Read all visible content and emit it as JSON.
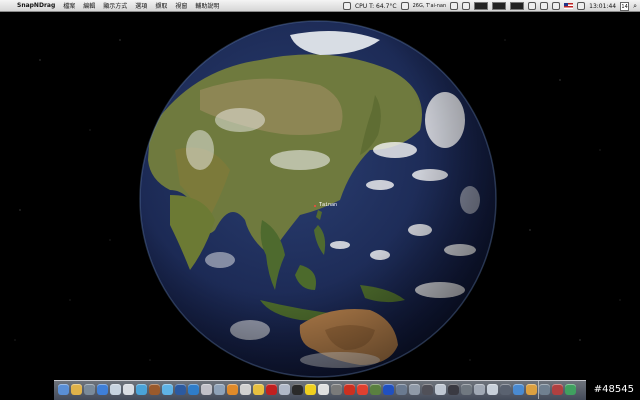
{
  "menubar": {
    "app_name": "SnapNDrag",
    "menus": [
      "檔案",
      "編輯",
      "顯示方式",
      "選項",
      "擷取",
      "視窗",
      "輔助說明"
    ],
    "cpu_label": "CPU T:",
    "cpu_temp": "64.7°C",
    "weather": "26G, T'ai-nan",
    "clock": "13:01:44",
    "calendar_day": "14"
  },
  "globe": {
    "location_label": "Tainan"
  },
  "dock": {
    "icon_count": 40
  },
  "watermark": "#48545"
}
